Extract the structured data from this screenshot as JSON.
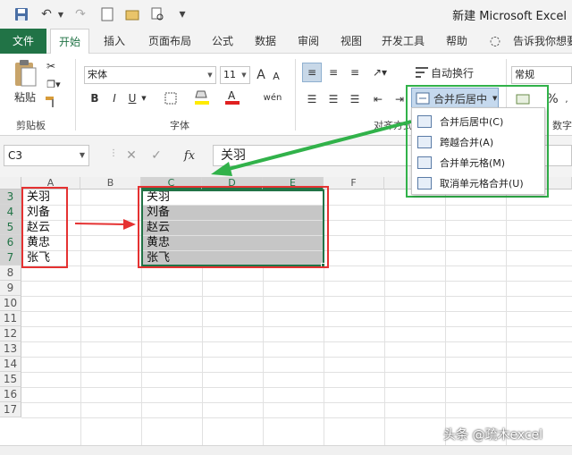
{
  "window": {
    "title": "新建 Microsoft Excel"
  },
  "tabs": [
    "文件",
    "开始",
    "插入",
    "页面布局",
    "公式",
    "数据",
    "审阅",
    "视图",
    "开发工具",
    "帮助"
  ],
  "tell_me": "告诉我你想要",
  "ribbon": {
    "paste_label": "粘贴",
    "clipboard_group": "剪贴板",
    "font_name": "宋体",
    "font_size": "11",
    "font_group": "字体",
    "bold": "B",
    "italic": "I",
    "underline": "U",
    "grow_font": "A",
    "shrink_font": "A",
    "phonetic": "wén",
    "wrap_text": "自动换行",
    "merge_center": "合并后居中",
    "alignment_group": "对齐方式",
    "number_format": "常规",
    "number_group": "数字",
    "percent": "%"
  },
  "merge_menu": {
    "items": [
      "合并后居中(C)",
      "跨越合并(A)",
      "合并单元格(M)",
      "取消单元格合并(U)"
    ]
  },
  "formula_bar": {
    "name_box": "C3",
    "fx": "fx",
    "value": "关羽"
  },
  "sheet": {
    "columns": [
      "A",
      "B",
      "C",
      "D",
      "E",
      "F"
    ],
    "rows": [
      "3",
      "4",
      "5",
      "6",
      "7",
      "8",
      "9",
      "10",
      "11",
      "12",
      "13",
      "14",
      "15",
      "16",
      "17"
    ],
    "col_a_values": [
      "关羽",
      "刘备",
      "赵云",
      "黄忠",
      "张飞"
    ],
    "col_c_values": [
      "关羽",
      "刘备",
      "赵云",
      "黄忠",
      "张飞"
    ]
  },
  "watermark": "头条 @疏木excel",
  "colors": {
    "excel_green": "#217346",
    "annotation_red": "#e53232",
    "annotation_green": "#31b24a"
  }
}
